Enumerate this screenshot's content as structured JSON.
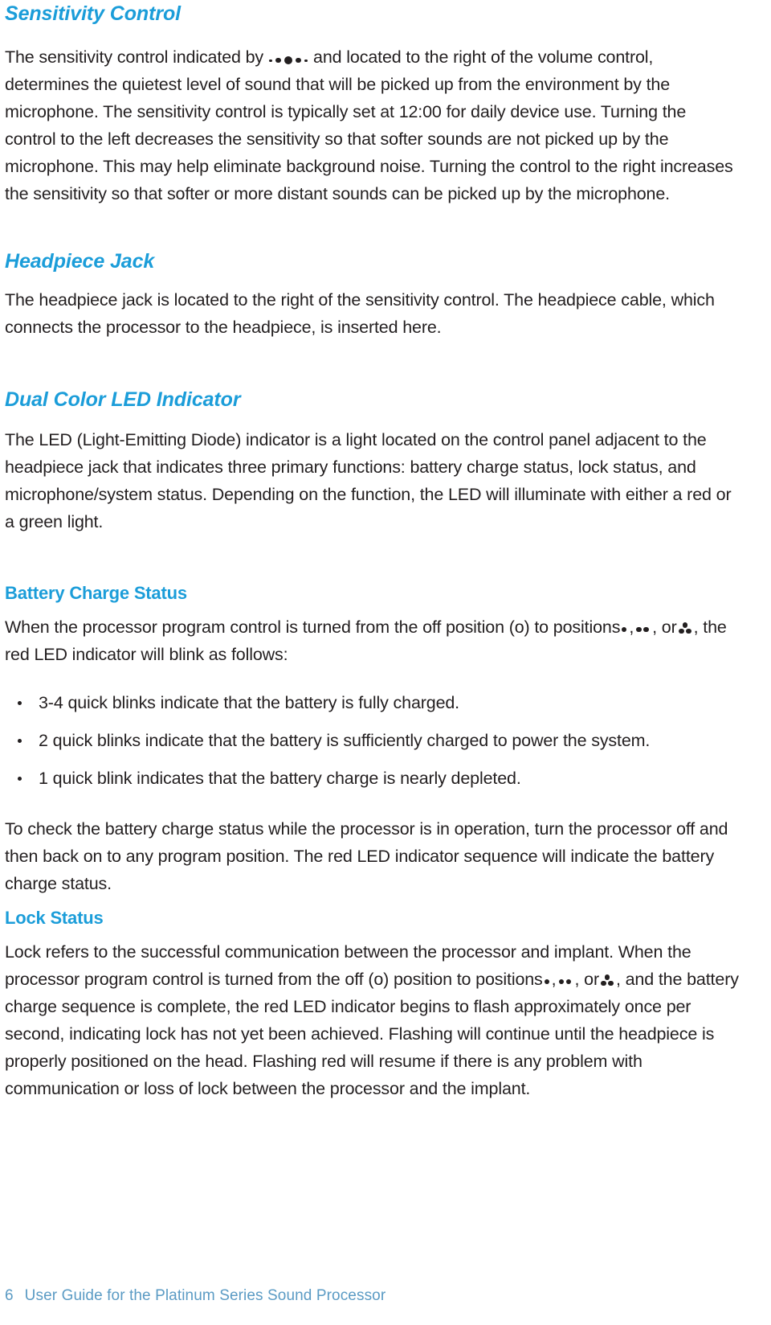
{
  "document": {
    "page_number": "6",
    "footer_text": "User Guide for the Platinum Series Sound Processor",
    "accent_color": "#1b9dd9",
    "footer_color": "#5b9bc4",
    "body_color": "#231f20"
  },
  "sections": [
    {
      "id": "sensitivity-control",
      "heading": "Sensitivity Control",
      "heading_style": "italic",
      "paragraphs": [
        {
          "parts": [
            {
              "type": "text",
              "value": "The sensitivity control indicated by "
            },
            {
              "type": "icon",
              "name": "sensitivity-dial-scale-symbol"
            },
            {
              "type": "text",
              "value": " and located to the right of the volume control, determines the quietest level of sound that will be picked up from the environment by the microphone. The sensitivity control is typically set at 12:00 for daily device use. Turning the control to the left decreases the sensitivity so that softer sounds are not picked up by the microphone. This may help eliminate background noise. Turning the control to the right increases the sensitivity so that softer or more distant sounds can be picked up by the microphone."
            }
          ]
        }
      ]
    },
    {
      "id": "headpiece-jack",
      "heading": "Headpiece Jack",
      "heading_style": "italic",
      "paragraphs": [
        {
          "parts": [
            {
              "type": "text",
              "value": "The headpiece jack is located to the right of the sensitivity control. The headpiece cable, which connects the processor to the headpiece, is inserted here."
            }
          ]
        }
      ]
    },
    {
      "id": "dual-color-led-indicator",
      "heading": "Dual Color LED Indicator",
      "heading_style": "italic",
      "paragraphs": [
        {
          "parts": [
            {
              "type": "text",
              "value": "The LED (Light-Emitting Diode) indicator is a light located on the control panel adjacent to the headpiece jack that indicates three primary functions: battery charge status, lock status, and microphone/system status. Depending on the function, the LED will illuminate with either a red or a green light."
            }
          ]
        }
      ]
    },
    {
      "id": "battery-charge-status",
      "heading": "Battery Charge Status",
      "heading_style": "plain",
      "paragraphs": [
        {
          "parts": [
            {
              "type": "text",
              "value": "When the processor program control is turned from the off position (o) to positions "
            },
            {
              "type": "icon",
              "name": "one-dot-program-symbol"
            },
            {
              "type": "text",
              "value": ", "
            },
            {
              "type": "icon",
              "name": "two-dot-program-symbol"
            },
            {
              "type": "text",
              "value": " , or "
            },
            {
              "type": "icon",
              "name": "three-dot-program-symbol"
            },
            {
              "type": "text",
              "value": ", the red LED indicator will blink as follows:"
            }
          ]
        }
      ],
      "bullets": [
        "3-4 quick blinks indicate that the battery is fully charged.",
        "2 quick blinks indicate that the battery is sufficiently charged to power the system.",
        "1 quick blink indicates that the battery charge is nearly depleted."
      ],
      "paragraphs_after": [
        {
          "parts": [
            {
              "type": "text",
              "value": "To check the battery charge status while the processor is in operation, turn the processor off and then back on to any program position. The red LED indicator sequence will indicate the battery charge status."
            }
          ]
        }
      ]
    },
    {
      "id": "lock-status",
      "heading": "Lock Status",
      "heading_style": "plain",
      "paragraphs": [
        {
          "parts": [
            {
              "type": "text",
              "value": "Lock refers to the successful communication between the processor and implant. When the processor program control is turned from the off (o) position to positions "
            },
            {
              "type": "icon",
              "name": "one-dot-program-symbol"
            },
            {
              "type": "text",
              "value": ", "
            },
            {
              "type": "icon",
              "name": "two-dot-program-symbol"
            },
            {
              "type": "text",
              "value": " , or "
            },
            {
              "type": "icon",
              "name": "three-dot-program-symbol"
            },
            {
              "type": "text",
              "value": ", and the battery charge sequence is complete, the red LED indicator begins to flash approximately once per second, indicating lock has not yet been achieved. Flashing will continue until the headpiece is properly positioned on the head. Flashing red will resume if there is any problem with communication or loss of lock between the processor and the implant."
            }
          ]
        }
      ]
    }
  ],
  "text": {
    "sensitivity_heading": "Sensitivity Control",
    "sensitivity_p1_a": "The sensitivity control indicated by",
    "sensitivity_p1_b": "and located to the right of the volume control, determines the quietest level of sound that will be picked up from the environment by the microphone. The sensitivity control is typically set at 12:00 for daily device use. Turning the control to the left decreases the sensitivity so that softer sounds are not picked up by the microphone. This may help eliminate background noise. Turning the control to the right increases the sensitivity so that softer or more distant sounds can be picked up by the microphone.",
    "headpiece_heading": "Headpiece Jack",
    "headpiece_p1": "The headpiece jack is located to the right of the sensitivity control. The headpiece cable, which connects the processor to the headpiece, is inserted here.",
    "led_heading": "Dual Color LED Indicator",
    "led_p1": "The LED (Light-Emitting Diode) indicator is a light located on the control panel adjacent to the headpiece jack that indicates three primary functions: battery charge status, lock status, and microphone/system status. Depending on the function, the LED will illuminate with either a red or a green light.",
    "battery_heading": "Battery Charge Status",
    "battery_p1_a": "When the processor program control is turned from the off position (o) to positions",
    "battery_p1_b": ",",
    "battery_p1_c": ", or",
    "battery_p1_d": ", the red LED indicator will blink as follows:",
    "battery_bullet_1": "3-4 quick blinks indicate that the battery is fully charged.",
    "battery_bullet_2": "2 quick blinks indicate that the battery is sufficiently charged to power the system.",
    "battery_bullet_3": "1 quick blink indicates that the battery charge is nearly depleted.",
    "battery_p2": "To check the battery charge status while the processor is in operation, turn the processor off and then back on to any program position. The red LED indicator sequence will indicate the battery charge status.",
    "lock_heading": "Lock Status",
    "lock_p1_a": "Lock refers to the successful communication between the processor and implant. When the processor program control is turned from the off (o) position to positions",
    "lock_p1_b": ",",
    "lock_p1_c": ", or",
    "lock_p1_d": ", and the battery charge sequence is complete, the red LED indicator begins to flash approximately once per second, indicating lock has not yet been achieved. Flashing will continue until the headpiece is properly positioned on the head. Flashing red will resume if there is any problem with communication or loss of lock between the processor and the implant.",
    "footer_page": "6",
    "footer_title": "User Guide for the Platinum Series Sound Processor"
  }
}
